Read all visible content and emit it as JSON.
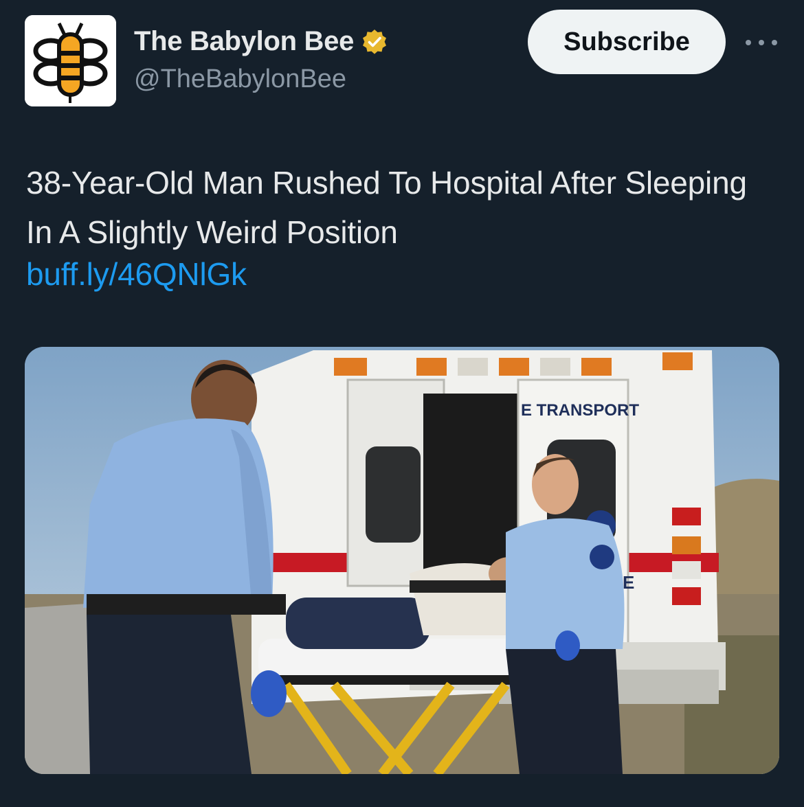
{
  "account": {
    "display_name": "The Babylon Bee",
    "handle": "@TheBabylonBee",
    "verified_icon": "verified-badge-icon",
    "avatar_icon": "bee-logo-icon"
  },
  "actions": {
    "subscribe_label": "Subscribe",
    "more_icon": "more-horizontal-icon"
  },
  "tweet": {
    "text": "38-Year-Old Man Rushed To Hospital After Sleeping In A Slightly Weird Position",
    "link": "buff.ly/46QNlGk"
  },
  "media": {
    "ambulance_text": "E TRANSPORT",
    "ambulance_side_letter": "E"
  },
  "colors": {
    "background": "#15202b",
    "link": "#1d9bf0",
    "verified_gold": "#e8b82f",
    "button_bg": "#eff3f4"
  }
}
